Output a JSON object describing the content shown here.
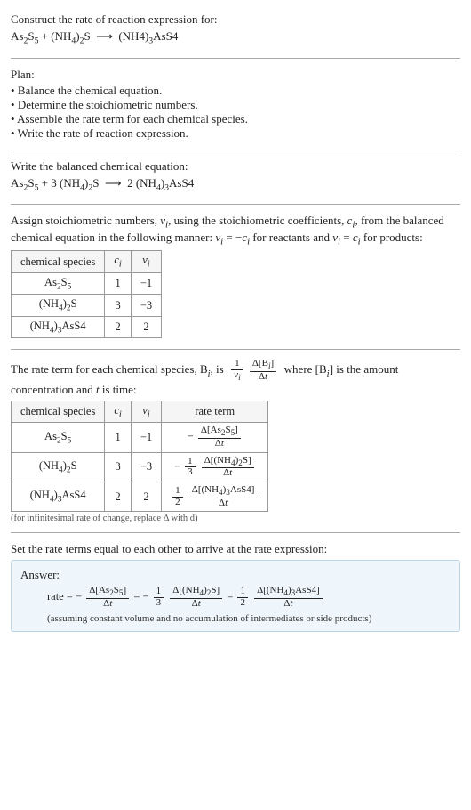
{
  "section_prompt": {
    "title": "Construct the rate of reaction expression for:",
    "equation_html": "As<sub>2</sub>S<sub>5</sub> + (NH<sub>4</sub>)<sub>2</sub>S &nbsp;&#10230;&nbsp; (NH4)<sub>3</sub>AsS4"
  },
  "plan": {
    "heading": "Plan:",
    "items": [
      "Balance the chemical equation.",
      "Determine the stoichiometric numbers.",
      "Assemble the rate term for each chemical species.",
      "Write the rate of reaction expression."
    ]
  },
  "balanced": {
    "heading": "Write the balanced chemical equation:",
    "equation_html": "As<sub>2</sub>S<sub>5</sub> + 3 (NH<sub>4</sub>)<sub>2</sub>S &nbsp;&#10230;&nbsp; 2 (NH<sub>4</sub>)<sub>3</sub>AsS4"
  },
  "stoich": {
    "intro_html": "Assign stoichiometric numbers, <span class='inline-it'>ν<sub>i</sub></span>, using the stoichiometric coefficients, <span class='inline-it'>c<sub>i</sub></span>, from the balanced chemical equation in the following manner: <span class='inline-it'>ν<sub>i</sub></span> = −<span class='inline-it'>c<sub>i</sub></span> for reactants and <span class='inline-it'>ν<sub>i</sub></span> = <span class='inline-it'>c<sub>i</sub></span> for products:",
    "headers": [
      "chemical species",
      "cᵢ",
      "νᵢ"
    ],
    "rows": [
      {
        "species_html": "As<sub>2</sub>S<sub>5</sub>",
        "c": "1",
        "nu": "−1"
      },
      {
        "species_html": "(NH<sub>4</sub>)<sub>2</sub>S",
        "c": "3",
        "nu": "−3"
      },
      {
        "species_html": "(NH<sub>4</sub>)<sub>3</sub>AsS4",
        "c": "2",
        "nu": "2"
      }
    ]
  },
  "rate_term": {
    "intro_html": "The rate term for each chemical species, B<span class='inline-sub'><i>i</i></span>, is &nbsp;<span class='frac'><span class='num'>1</span><span class='den'><i>ν<sub>i</sub></i></span></span> <span class='frac'><span class='num'>Δ[B<sub><i>i</i></sub>]</span><span class='den'>Δ<i>t</i></span></span>&nbsp; where [B<sub><i>i</i></sub>] is the amount concentration and <i>t</i> is time:",
    "headers": [
      "chemical species",
      "cᵢ",
      "νᵢ",
      "rate term"
    ],
    "rows": [
      {
        "species_html": "As<sub>2</sub>S<sub>5</sub>",
        "c": "1",
        "nu": "−1",
        "rate_html": "− <span class='frac'><span class='num'>Δ[As<sub>2</sub>S<sub>5</sub>]</span><span class='den'>Δ<i>t</i></span></span>"
      },
      {
        "species_html": "(NH<sub>4</sub>)<sub>2</sub>S",
        "c": "3",
        "nu": "−3",
        "rate_html": "− <span class='frac'><span class='num'>1</span><span class='den'>3</span></span> <span class='frac'><span class='num'>Δ[(NH<sub>4</sub>)<sub>2</sub>S]</span><span class='den'>Δ<i>t</i></span></span>"
      },
      {
        "species_html": "(NH<sub>4</sub>)<sub>3</sub>AsS4",
        "c": "2",
        "nu": "2",
        "rate_html": "<span class='frac'><span class='num'>1</span><span class='den'>2</span></span> <span class='frac'><span class='num'>Δ[(NH<sub>4</sub>)<sub>3</sub>AsS4]</span><span class='den'>Δ<i>t</i></span></span>"
      }
    ],
    "note": "(for infinitesimal rate of change, replace Δ with d)"
  },
  "final": {
    "heading": "Set the rate terms equal to each other to arrive at the rate expression:",
    "answer_label": "Answer:",
    "equation_html": "rate = − <span class='frac'><span class='num'>Δ[As<sub>2</sub>S<sub>5</sub>]</span><span class='den'>Δ<i>t</i></span></span> = − <span class='frac'><span class='num'>1</span><span class='den'>3</span></span> <span class='frac'><span class='num'>Δ[(NH<sub>4</sub>)<sub>2</sub>S]</span><span class='den'>Δ<i>t</i></span></span> = <span class='frac'><span class='num'>1</span><span class='den'>2</span></span> <span class='frac'><span class='num'>Δ[(NH<sub>4</sub>)<sub>3</sub>AsS4]</span><span class='den'>Δ<i>t</i></span></span>",
    "assumption": "(assuming constant volume and no accumulation of intermediates or side products)"
  },
  "chart_data": {
    "type": "table",
    "tables": [
      {
        "title": "stoichiometric numbers",
        "columns": [
          "chemical species",
          "c_i",
          "nu_i"
        ],
        "rows": [
          [
            "As2S5",
            1,
            -1
          ],
          [
            "(NH4)2S",
            3,
            -3
          ],
          [
            "(NH4)3AsS4",
            2,
            2
          ]
        ]
      },
      {
        "title": "rate terms",
        "columns": [
          "chemical species",
          "c_i",
          "nu_i",
          "rate term"
        ],
        "rows": [
          [
            "As2S5",
            1,
            -1,
            "-Δ[As2S5]/Δt"
          ],
          [
            "(NH4)2S",
            3,
            -3,
            "-(1/3) Δ[(NH4)2S]/Δt"
          ],
          [
            "(NH4)3AsS4",
            2,
            2,
            "(1/2) Δ[(NH4)3AsS4]/Δt"
          ]
        ]
      }
    ]
  }
}
